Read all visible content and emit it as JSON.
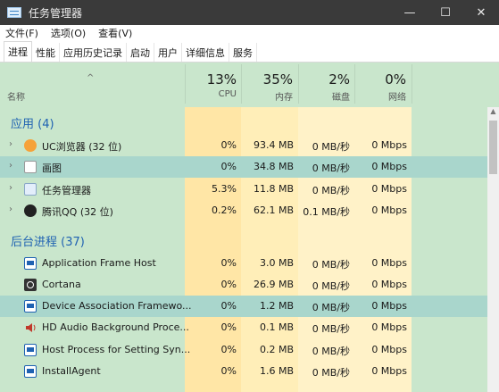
{
  "window": {
    "title": "任务管理器",
    "controls": [
      "—",
      "☐",
      "✕"
    ]
  },
  "menu": [
    "文件(F)",
    "选项(O)",
    "查看(V)"
  ],
  "tabs": [
    "进程",
    "性能",
    "应用历史记录",
    "启动",
    "用户",
    "详细信息",
    "服务"
  ],
  "header": {
    "name_label": "名称",
    "sort_arrow": "^",
    "columns": [
      {
        "pct": "13%",
        "label": "CPU"
      },
      {
        "pct": "35%",
        "label": "内存"
      },
      {
        "pct": "2%",
        "label": "磁盘"
      },
      {
        "pct": "0%",
        "label": "网络"
      }
    ]
  },
  "groups": {
    "apps": {
      "label": "应用 (4)"
    },
    "background": {
      "label": "后台进程 (37)"
    }
  },
  "rows": [
    {
      "name": "UC浏览器 (32 位)",
      "icon": "uc-browser-icon",
      "chevron": "›",
      "cpu": "0%",
      "mem": "93.4 MB",
      "disk": "0 MB/秒",
      "net": "0 Mbps"
    },
    {
      "name": "画图",
      "icon": "paint-icon",
      "chevron": "›",
      "cpu": "0%",
      "mem": "34.8 MB",
      "disk": "0 MB/秒",
      "net": "0 Mbps",
      "selected": true
    },
    {
      "name": "任务管理器",
      "icon": "task-manager-icon",
      "chevron": "›",
      "cpu": "5.3%",
      "mem": "11.8 MB",
      "disk": "0 MB/秒",
      "net": "0 Mbps"
    },
    {
      "name": "腾讯QQ (32 位)",
      "icon": "qq-icon",
      "chevron": "›",
      "cpu": "0.2%",
      "mem": "62.1 MB",
      "disk": "0.1 MB/秒",
      "net": "0 Mbps"
    },
    {
      "name": "Application Frame Host",
      "icon": "window-icon",
      "chevron": "",
      "cpu": "0%",
      "mem": "3.0 MB",
      "disk": "0 MB/秒",
      "net": "0 Mbps"
    },
    {
      "name": "Cortana",
      "icon": "cortana-icon",
      "chevron": "",
      "cpu": "0%",
      "mem": "26.9 MB",
      "disk": "0 MB/秒",
      "net": "0 Mbps"
    },
    {
      "name": "Device Association Framewo...",
      "icon": "window-icon",
      "chevron": "",
      "cpu": "0%",
      "mem": "1.2 MB",
      "disk": "0 MB/秒",
      "net": "0 Mbps",
      "selected": true
    },
    {
      "name": "HD Audio Background Proce...",
      "icon": "speaker-icon",
      "chevron": "",
      "cpu": "0%",
      "mem": "0.1 MB",
      "disk": "0 MB/秒",
      "net": "0 Mbps"
    },
    {
      "name": "Host Process for Setting Syn...",
      "icon": "window-icon",
      "chevron": "",
      "cpu": "0%",
      "mem": "0.2 MB",
      "disk": "0 MB/秒",
      "net": "0 Mbps"
    },
    {
      "name": "InstallAgent",
      "icon": "window-icon",
      "chevron": "",
      "cpu": "0%",
      "mem": "1.6 MB",
      "disk": "0 MB/秒",
      "net": "0 Mbps"
    }
  ],
  "colors": {
    "group_blue": "#1f62b2",
    "heat_light": "#fff2c8",
    "heat_medium": "#ffe6a6",
    "row_selected": "#a9d6cc",
    "background": "#c9e6cc"
  }
}
